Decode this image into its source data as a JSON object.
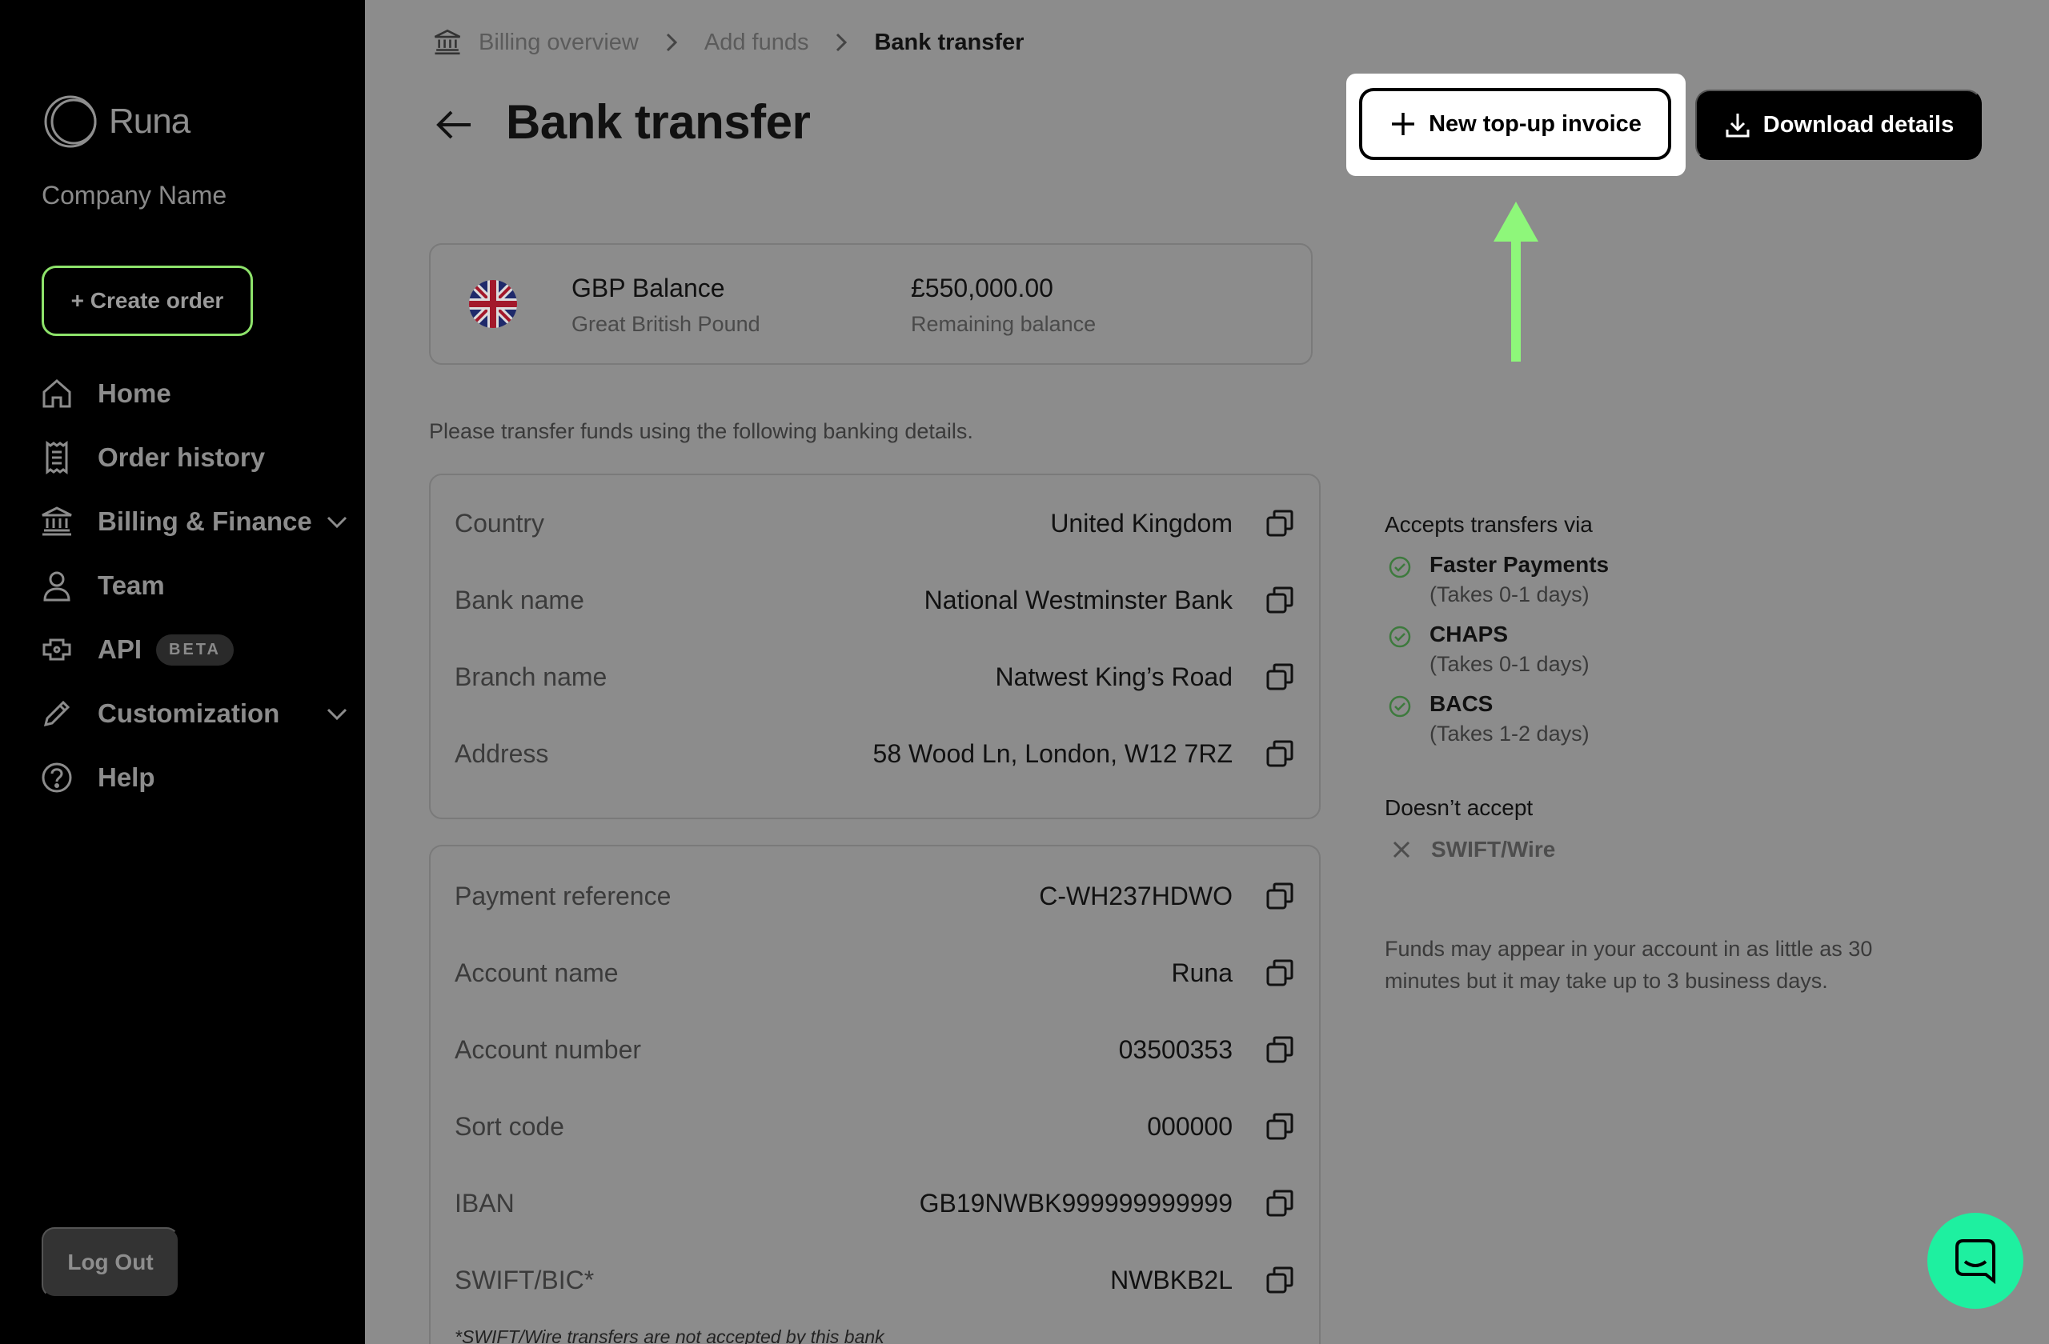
{
  "app": {
    "logo_text": "Runa",
    "company": "Company Name"
  },
  "sidebar": {
    "create_order": "+ Create order",
    "items": [
      {
        "label": "Home",
        "icon": "home-icon"
      },
      {
        "label": "Order history",
        "icon": "receipt-icon"
      },
      {
        "label": "Billing & Finance",
        "icon": "bank-icon",
        "expandable": true
      },
      {
        "label": "Team",
        "icon": "user-icon"
      },
      {
        "label": "API",
        "icon": "api-icon",
        "badge": "BETA"
      },
      {
        "label": "Customization",
        "icon": "pencil-icon",
        "expandable": true
      },
      {
        "label": "Help",
        "icon": "help-icon"
      }
    ],
    "logout": "Log Out"
  },
  "breadcrumb": [
    "Billing overview",
    "Add funds",
    "Bank transfer"
  ],
  "page": {
    "title": "Bank transfer",
    "new_invoice_button": "New top-up invoice",
    "download_button": "Download details"
  },
  "balance": {
    "name": "GBP Balance",
    "currency": "Great British Pound",
    "amount": "£550,000.00",
    "amount_label": "Remaining balance"
  },
  "instruction": "Please transfer funds using the following banking details.",
  "bank_details": [
    {
      "label": "Country",
      "value": "United Kingdom"
    },
    {
      "label": "Bank name",
      "value": "National Westminster Bank"
    },
    {
      "label": "Branch name",
      "value": "Natwest King’s Road"
    },
    {
      "label": "Address",
      "value": "58 Wood Ln, London, W12 7RZ"
    }
  ],
  "account_details": [
    {
      "label": "Payment reference",
      "value": "C-WH237HDWO"
    },
    {
      "label": "Account name",
      "value": "Runa"
    },
    {
      "label": "Account number",
      "value": "03500353"
    },
    {
      "label": "Sort code",
      "value": "000000"
    },
    {
      "label": "IBAN",
      "value": "GB19NWBK999999999999"
    },
    {
      "label": "SWIFT/BIC*",
      "value": "NWBKB2L"
    }
  ],
  "footnote": "*SWIFT/Wire transfers are not accepted by this bank",
  "transfers": {
    "accepts_heading": "Accepts transfers via",
    "accepted": [
      {
        "name": "Faster Payments",
        "time": "(Takes 0-1 days)"
      },
      {
        "name": "CHAPS",
        "time": "(Takes 0-1 days)"
      },
      {
        "name": "BACS",
        "time": "(Takes 1-2 days)"
      }
    ],
    "rejects_heading": "Doesn’t accept",
    "rejected": "SWIFT/Wire",
    "note": "Funds may appear in your account in as little as 30 minutes but it may take up to 3 business days."
  },
  "colors": {
    "accent_green": "#8ee36b",
    "chat_green": "#1ef0a0",
    "sidebar_bg": "#000000"
  }
}
